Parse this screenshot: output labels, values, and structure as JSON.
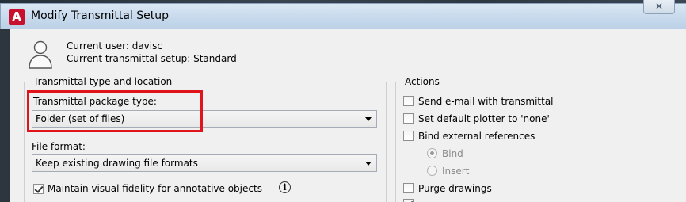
{
  "window": {
    "title": "Modify Transmittal Setup",
    "app_icon_glyph": "A",
    "close_glyph": "✕"
  },
  "user_info": {
    "current_user": "Current user: davisc",
    "current_setup": "Current transmittal setup: Standard"
  },
  "transmittal_group": {
    "legend": "Transmittal type and location",
    "package_type_label": "Transmittal package type:",
    "package_type_value": "Folder (set of files)",
    "file_format_label": "File format:",
    "file_format_value": "Keep existing drawing file formats",
    "maintain_fidelity_label": "Maintain visual fidelity for annotative objects",
    "maintain_fidelity_checked": true,
    "info_glyph": "i"
  },
  "actions_group": {
    "legend": "Actions",
    "send_email_label": "Send e-mail with transmittal",
    "set_plotter_label": "Set default plotter to 'none'",
    "bind_xrefs_label": "Bind external references",
    "bind_label": "Bind",
    "insert_label": "Insert",
    "purge_label": "Purge drawings",
    "bind_selected": true
  },
  "colors": {
    "highlight": "#e0141b",
    "app_icon_red": "#c8102e",
    "titlebar": "#c9dbed",
    "dialog_bg": "#f0f0f0"
  },
  "icons": {
    "app": "autocad-icon",
    "user": "user-silhouette-icon",
    "dropdown": "chevron-down-icon",
    "info": "info-icon",
    "close": "close-icon"
  }
}
